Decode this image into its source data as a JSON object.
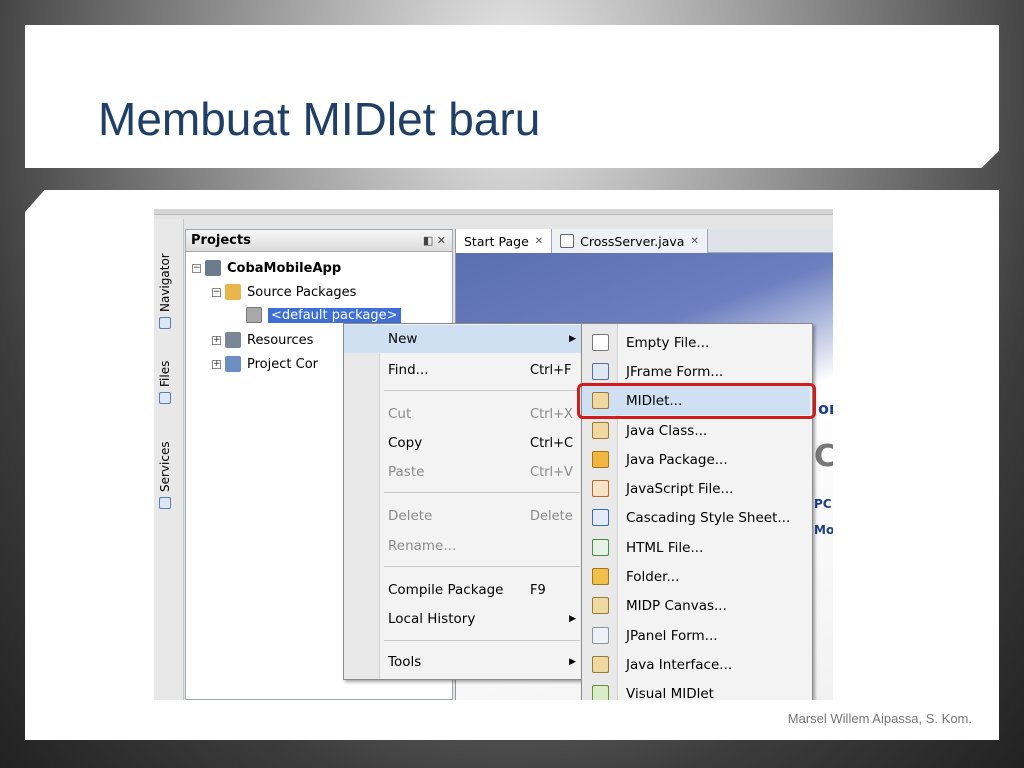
{
  "slide": {
    "title": "Membuat MIDlet baru",
    "footer": "Marsel Willem Aipassa, S. Kom."
  },
  "ide": {
    "side_tabs": [
      "Navigator",
      "Files",
      "Services"
    ],
    "projects_panel": {
      "title": "Projects",
      "tree": [
        {
          "label": "CobaMobileApp"
        },
        {
          "label": "Source Packages"
        },
        {
          "label": "<default package>"
        },
        {
          "label": "Resources"
        },
        {
          "label": "Project Cor"
        }
      ]
    },
    "editor_tabs": [
      "Start Page",
      "CrossServer.java"
    ],
    "start_page_fragments": [
      "or",
      "C",
      "PC",
      "Mo"
    ],
    "context_menu": {
      "items": [
        {
          "label": "New",
          "shortcut": ""
        },
        {
          "label": "Find...",
          "shortcut": "Ctrl+F"
        },
        {
          "label": "Cut",
          "shortcut": "Ctrl+X"
        },
        {
          "label": "Copy",
          "shortcut": "Ctrl+C"
        },
        {
          "label": "Paste",
          "shortcut": "Ctrl+V"
        },
        {
          "label": "Delete",
          "shortcut": "Delete"
        },
        {
          "label": "Rename...",
          "shortcut": ""
        },
        {
          "label": "Compile Package",
          "shortcut": "F9"
        },
        {
          "label": "Local History",
          "shortcut": ""
        },
        {
          "label": "Tools",
          "shortcut": ""
        }
      ]
    },
    "new_submenu": {
      "items": [
        {
          "label": "Empty File...",
          "icon": "empty-file-icon"
        },
        {
          "label": "JFrame Form...",
          "icon": "jframe-icon"
        },
        {
          "label": "MIDlet...",
          "icon": "midlet-icon"
        },
        {
          "label": "Java Class...",
          "icon": "java-class-icon"
        },
        {
          "label": "Java Package...",
          "icon": "package-icon"
        },
        {
          "label": "JavaScript File...",
          "icon": "javascript-icon"
        },
        {
          "label": "Cascading Style Sheet...",
          "icon": "css-icon"
        },
        {
          "label": "HTML File...",
          "icon": "html-icon"
        },
        {
          "label": "Folder...",
          "icon": "folder-icon"
        },
        {
          "label": "MIDP Canvas...",
          "icon": "canvas-icon"
        },
        {
          "label": "JPanel Form...",
          "icon": "jpanel-icon"
        },
        {
          "label": "Java Interface...",
          "icon": "interface-icon"
        },
        {
          "label": "Visual MIDlet",
          "icon": "visual-midlet-icon"
        }
      ]
    }
  },
  "colors": {
    "title": "#1f3f66",
    "highlight_box": "#d21c1c",
    "selection": "#3d6fd6"
  }
}
